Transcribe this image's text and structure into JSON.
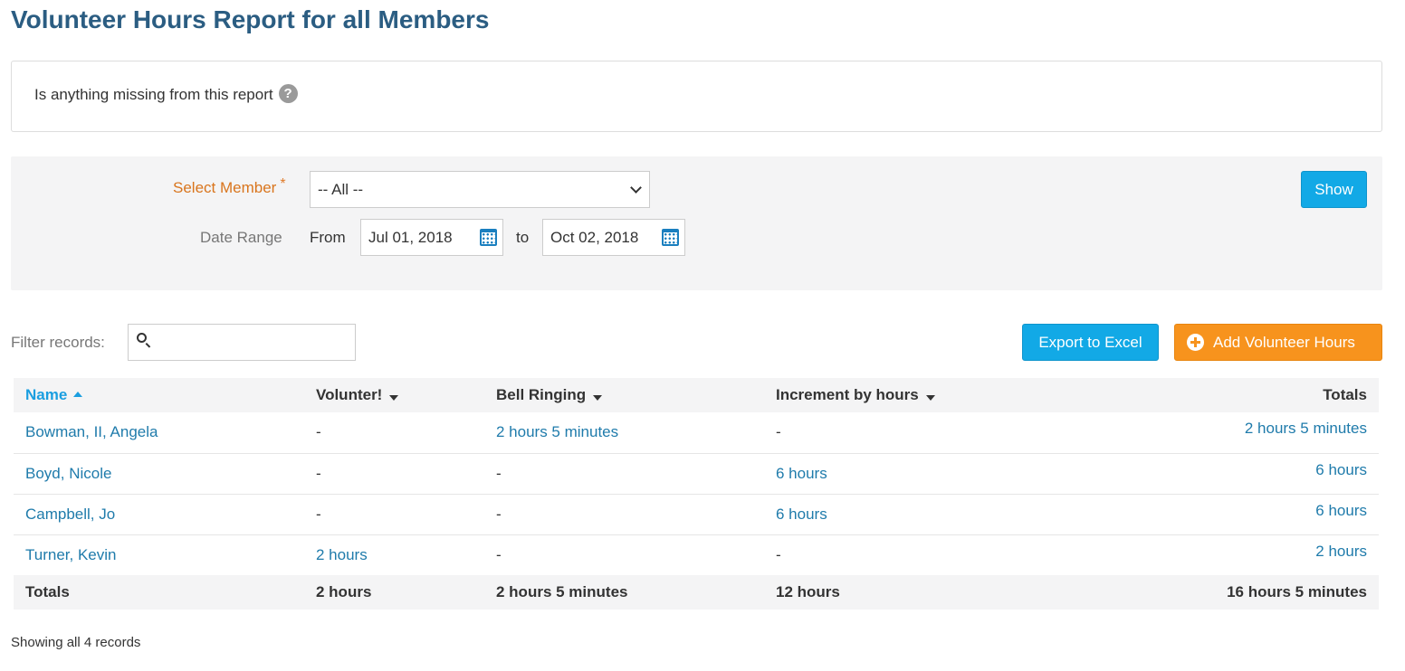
{
  "page": {
    "title": "Volunteer Hours Report for all Members"
  },
  "notice": {
    "text": "Is anything missing from this report",
    "help_icon": "?"
  },
  "filters": {
    "member_label": "Select Member",
    "required_mark": "*",
    "member_value": "-- All --",
    "date_range_label": "Date Range",
    "from_label": "From",
    "from_value": "Jul 01, 2018",
    "to_label": "to",
    "to_value": "Oct 02, 2018",
    "show_button": "Show"
  },
  "toolbar": {
    "filter_label": "Filter records:",
    "filter_value": "",
    "export_button": "Export to Excel",
    "add_button": "Add Volunteer Hours"
  },
  "table": {
    "headers": {
      "name": "Name",
      "volunteer": "Volunter!",
      "bell": "Bell Ringing",
      "increment": "Increment by hours",
      "totals": "Totals"
    },
    "rows": [
      {
        "name": "Bowman, II, Angela",
        "volunteer": "-",
        "bell": "2 hours 5 minutes",
        "increment": "-",
        "total": "2 hours 5 minutes"
      },
      {
        "name": "Boyd, Nicole",
        "volunteer": "-",
        "bell": "-",
        "increment": "6 hours",
        "total": "6 hours"
      },
      {
        "name": "Campbell, Jo",
        "volunteer": "-",
        "bell": "-",
        "increment": "6 hours",
        "total": "6 hours"
      },
      {
        "name": "Turner, Kevin",
        "volunteer": "2 hours",
        "bell": "-",
        "increment": "-",
        "total": "2 hours"
      }
    ],
    "totals_row": {
      "label": "Totals",
      "volunteer": "2 hours",
      "bell": "2 hours 5 minutes",
      "increment": "12 hours",
      "total": "16 hours 5 minutes"
    }
  },
  "footer": {
    "record_count": "Showing all 4 records"
  },
  "colors": {
    "title": "#2b5d82",
    "accent_blue": "#12a9e6",
    "accent_orange": "#f7931d",
    "link": "#1f7bab",
    "label_orange": "#d9751d"
  }
}
